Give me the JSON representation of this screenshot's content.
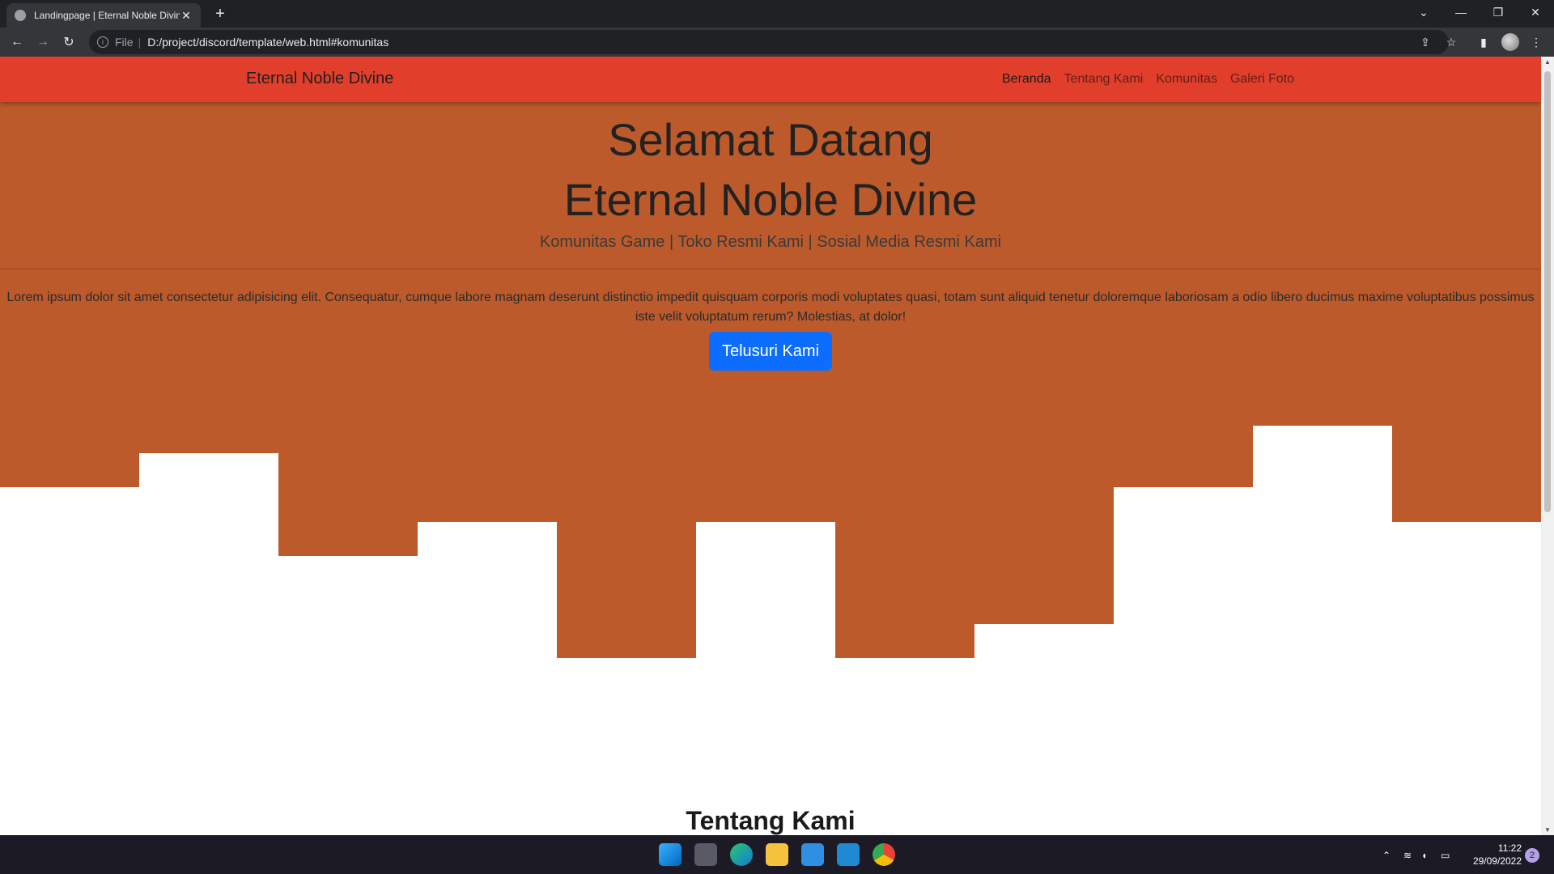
{
  "browser": {
    "tab_title": "Landingpage | Eternal Noble Divine",
    "new_tab": "+",
    "address": "D:/project/discord/template/web.html#komunitas",
    "file_label": "File",
    "separator": "|"
  },
  "navbar": {
    "brand": "Eternal Noble Divine",
    "links": [
      "Beranda",
      "Tentang Kami",
      "Komunitas",
      "Galeri Foto"
    ]
  },
  "hero": {
    "title_line1": "Selamat Datang",
    "title_line2": "Eternal Noble Divine",
    "lead": "Komunitas Game | Toko Resmi Kami | Sosial Media Resmi Kami",
    "paragraph": "Lorem ipsum dolor sit amet consectetur adipisicing elit. Consequatur, cumque labore magnam deserunt distinctio impedit quisquam corporis modi voluptates quasi, totam sunt aliquid tenetur doloremque laboriosam a odio libero ducimus maxime voluptatibus possimus iste velit voluptatum rerum? Molestias, at dolor!",
    "button": "Telusuri Kami"
  },
  "section": {
    "title": "Tentang Kami"
  },
  "taskbar": {
    "time": "11:22",
    "date": "29/09/2022",
    "notifications": "2"
  },
  "colors": {
    "navbar": "#e13f2c",
    "hero": "#bc5a2b",
    "button": "#0d6efd"
  }
}
